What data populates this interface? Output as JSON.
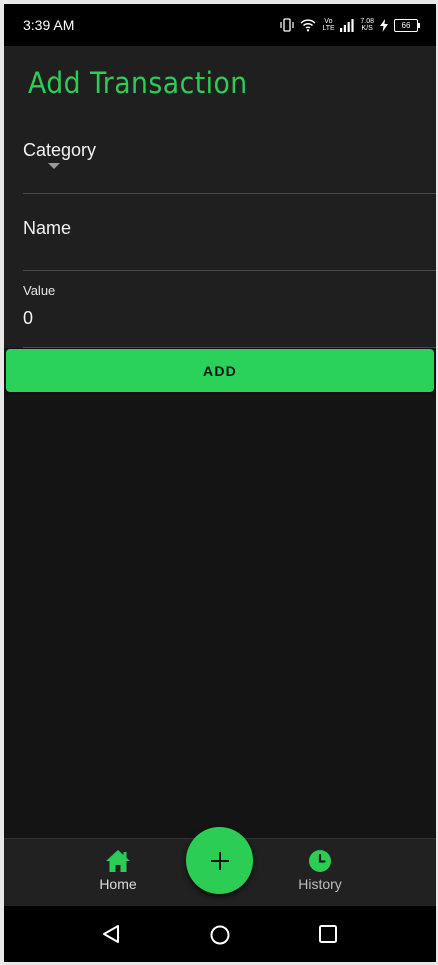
{
  "status_bar": {
    "time": "3:39 AM",
    "network_label": "Vo LTE",
    "speed_value": "7.08",
    "speed_unit": "K/S",
    "battery": "66"
  },
  "app_bar": {
    "title": "Add Transaction"
  },
  "form": {
    "category": {
      "label": "Category",
      "selected": ""
    },
    "name": {
      "label": "Name",
      "value": ""
    },
    "value": {
      "label": "Value",
      "value": "0"
    },
    "add_button_label": "ADD"
  },
  "bottom_nav": {
    "items": [
      {
        "label": "Home",
        "icon": "home-icon"
      },
      {
        "label": "History",
        "icon": "clock-icon"
      }
    ],
    "fab_icon": "plus-icon"
  },
  "colors": {
    "accent": "#2bcd55",
    "background": "#141414",
    "surface": "#1f1f1f"
  }
}
